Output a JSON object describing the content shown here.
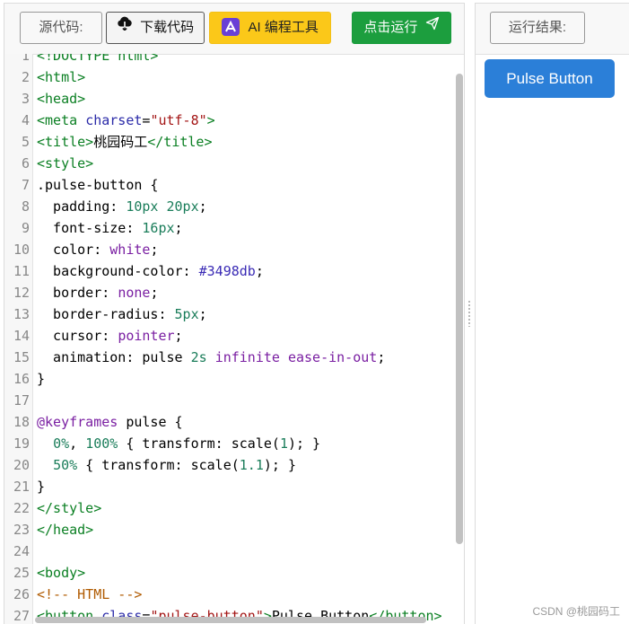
{
  "toolbar": {
    "source_label": "源代码:",
    "download_label": "下载代码",
    "ai_label": "AI 编程工具",
    "run_label": "点击运行",
    "result_label": "运行结果:"
  },
  "preview": {
    "button_label": "Pulse Button"
  },
  "watermark": "CSDN @桃园码工",
  "editor": {
    "lines": [
      {
        "n": "1",
        "code": [
          {
            "c": "t-tag",
            "t": "<!DOCTYPE html>"
          }
        ]
      },
      {
        "n": "2",
        "code": [
          {
            "c": "t-tag",
            "t": "<html>"
          }
        ]
      },
      {
        "n": "3",
        "code": [
          {
            "c": "t-tag",
            "t": "<head>"
          }
        ]
      },
      {
        "n": "4",
        "code": [
          {
            "c": "t-tag",
            "t": "<meta "
          },
          {
            "c": "t-attr",
            "t": "charset"
          },
          {
            "c": "",
            "t": "="
          },
          {
            "c": "t-str",
            "t": "\"utf-8\""
          },
          {
            "c": "t-tag",
            "t": ">"
          }
        ]
      },
      {
        "n": "5",
        "code": [
          {
            "c": "t-tag",
            "t": "<title>"
          },
          {
            "c": "",
            "t": "桃园码工"
          },
          {
            "c": "t-tag",
            "t": "</title>"
          }
        ]
      },
      {
        "n": "6",
        "code": [
          {
            "c": "t-tag",
            "t": "<style>"
          }
        ]
      },
      {
        "n": "7",
        "code": [
          {
            "c": "",
            "t": ".pulse-button {"
          }
        ]
      },
      {
        "n": "8",
        "code": [
          {
            "c": "",
            "t": "  padding: "
          },
          {
            "c": "t-num",
            "t": "10px 20px"
          },
          {
            "c": "",
            "t": ";"
          }
        ]
      },
      {
        "n": "9",
        "code": [
          {
            "c": "",
            "t": "  font-size: "
          },
          {
            "c": "t-num",
            "t": "16px"
          },
          {
            "c": "",
            "t": ";"
          }
        ]
      },
      {
        "n": "10",
        "code": [
          {
            "c": "",
            "t": "  color: "
          },
          {
            "c": "t-kw",
            "t": "white"
          },
          {
            "c": "",
            "t": ";"
          }
        ]
      },
      {
        "n": "11",
        "code": [
          {
            "c": "",
            "t": "  background-color: "
          },
          {
            "c": "t-hex",
            "t": "#3498db"
          },
          {
            "c": "",
            "t": ";"
          }
        ]
      },
      {
        "n": "12",
        "code": [
          {
            "c": "",
            "t": "  border: "
          },
          {
            "c": "t-kw",
            "t": "none"
          },
          {
            "c": "",
            "t": ";"
          }
        ]
      },
      {
        "n": "13",
        "code": [
          {
            "c": "",
            "t": "  border-radius: "
          },
          {
            "c": "t-num",
            "t": "5px"
          },
          {
            "c": "",
            "t": ";"
          }
        ]
      },
      {
        "n": "14",
        "code": [
          {
            "c": "",
            "t": "  cursor: "
          },
          {
            "c": "t-kw",
            "t": "pointer"
          },
          {
            "c": "",
            "t": ";"
          }
        ]
      },
      {
        "n": "15",
        "code": [
          {
            "c": "",
            "t": "  animation: pulse "
          },
          {
            "c": "t-num",
            "t": "2s"
          },
          {
            "c": "",
            "t": " "
          },
          {
            "c": "t-kw",
            "t": "infinite ease-in-out"
          },
          {
            "c": "",
            "t": ";"
          }
        ]
      },
      {
        "n": "16",
        "code": [
          {
            "c": "",
            "t": "}"
          }
        ]
      },
      {
        "n": "17",
        "code": [
          {
            "c": "",
            "t": ""
          }
        ]
      },
      {
        "n": "18",
        "code": [
          {
            "c": "t-at",
            "t": "@keyframes"
          },
          {
            "c": "",
            "t": " pulse {"
          }
        ]
      },
      {
        "n": "19",
        "code": [
          {
            "c": "",
            "t": "  "
          },
          {
            "c": "t-num",
            "t": "0%"
          },
          {
            "c": "",
            "t": ", "
          },
          {
            "c": "t-num",
            "t": "100%"
          },
          {
            "c": "",
            "t": " { transform: scale("
          },
          {
            "c": "t-num",
            "t": "1"
          },
          {
            "c": "",
            "t": "); }"
          }
        ]
      },
      {
        "n": "20",
        "code": [
          {
            "c": "",
            "t": "  "
          },
          {
            "c": "t-num",
            "t": "50%"
          },
          {
            "c": "",
            "t": " { transform: scale("
          },
          {
            "c": "t-num",
            "t": "1.1"
          },
          {
            "c": "",
            "t": "); }"
          }
        ]
      },
      {
        "n": "21",
        "code": [
          {
            "c": "",
            "t": "}"
          }
        ]
      },
      {
        "n": "22",
        "code": [
          {
            "c": "t-tag",
            "t": "</style>"
          }
        ]
      },
      {
        "n": "23",
        "code": [
          {
            "c": "t-tag",
            "t": "</head>"
          }
        ]
      },
      {
        "n": "24",
        "code": [
          {
            "c": "",
            "t": ""
          }
        ]
      },
      {
        "n": "25",
        "code": [
          {
            "c": "t-tag",
            "t": "<body>"
          }
        ]
      },
      {
        "n": "26",
        "code": [
          {
            "c": "t-com",
            "t": "<!-- HTML -->"
          }
        ]
      },
      {
        "n": "27",
        "code": [
          {
            "c": "t-tag",
            "t": "<button "
          },
          {
            "c": "t-attr",
            "t": "class"
          },
          {
            "c": "",
            "t": "="
          },
          {
            "c": "t-str",
            "t": "\"pulse-button\""
          },
          {
            "c": "t-tag",
            "t": ">"
          },
          {
            "c": "",
            "t": "Pulse Button"
          },
          {
            "c": "t-tag",
            "t": "</button>"
          }
        ]
      }
    ]
  }
}
